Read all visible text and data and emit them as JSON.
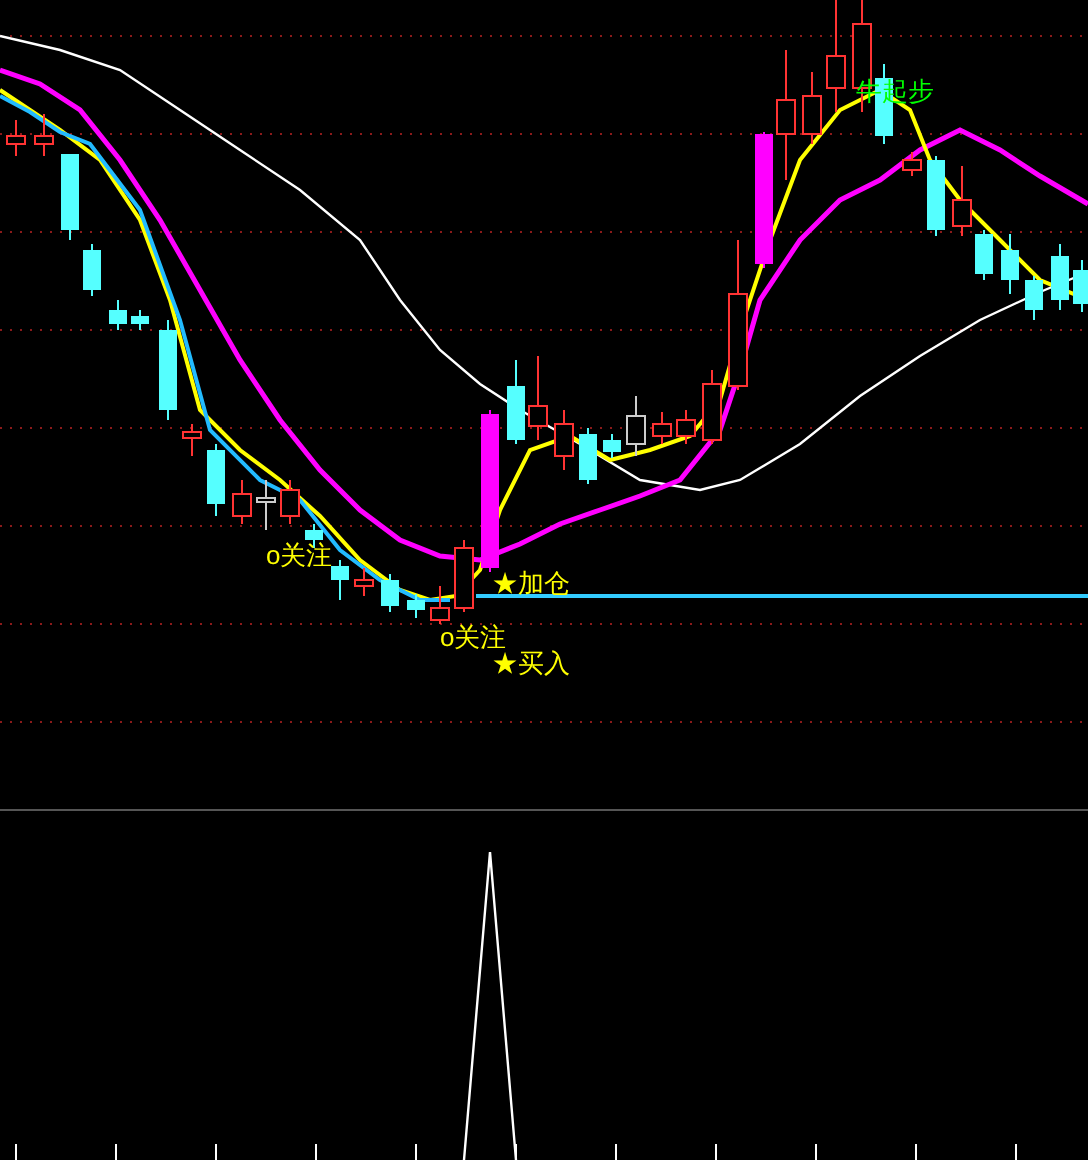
{
  "signals": [
    {
      "text": "牛起步",
      "color": "#00ff00"
    },
    {
      "text": "o关注",
      "color": "#ffff00"
    },
    {
      "text": "★加仓",
      "color": "#ffff00"
    },
    {
      "text": "o关注",
      "color": "#ffff00"
    },
    {
      "text": "★买入",
      "color": "#ffff00"
    }
  ]
}
